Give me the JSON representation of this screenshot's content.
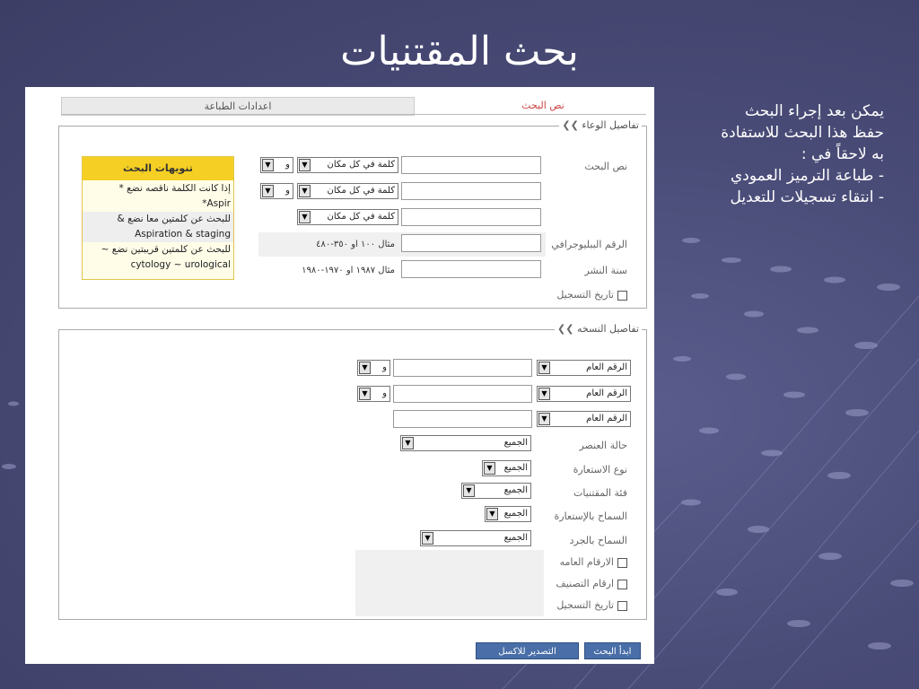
{
  "slide": {
    "title": "بحث المقتنيات",
    "notes": [
      "يمكن بعد إجراء البحث",
      "حفظ هذا البحث للاستفادة",
      "به لاحقاً في :",
      "- طباعة الترميز العمودي",
      "- انتقاء تسجيلات للتعديل"
    ]
  },
  "tabs": {
    "search_text": "نص البحث",
    "print_settings": "اعدادات الطباعة"
  },
  "container_details": {
    "legend": "تفاصيل الوعاء",
    "search_text_label": "نص البحث",
    "rows": [
      {
        "scope": "كلمة في كل مكان",
        "operator": "و"
      },
      {
        "scope": "كلمة في كل مكان",
        "operator": "و"
      },
      {
        "scope": "كلمة في كل مكان",
        "operator": ""
      }
    ],
    "biblio_label": "الرقم الببليوجرافي",
    "biblio_example": "مثال ١٠٠ او ٣٥٠-٤٨٠",
    "pub_year_label": "سنة النشر",
    "pub_year_example": "مثال ١٩٨٧ او ١٩٧٠-١٩٨٠",
    "registration_date_label": "تاريخ التسجيل"
  },
  "hints": {
    "title": "تنويهات البحث",
    "lines": [
      "إذا كانت الكلمة ناقصه نضع *",
      "Aspir*",
      "للبحث عن كلمتين معا نضع &",
      "Aspiration & staging",
      "للبحث عن كلمتين قريبتين نضع ~",
      "cytology ~ urological"
    ]
  },
  "copy_details": {
    "legend": "تفاصيل النسخه",
    "number_rows": [
      {
        "field": "الرقم العام",
        "operator": "و"
      },
      {
        "field": "الرقم العام",
        "operator": "و"
      },
      {
        "field": "الرقم العام",
        "operator": ""
      }
    ],
    "filters": [
      {
        "label": "حالة العنصر",
        "value": "الجميع"
      },
      {
        "label": "نوع الاستعارة",
        "value": "الجميع"
      },
      {
        "label": "فئة المقتنيات",
        "value": "الجميع"
      },
      {
        "label": "السماح بالإستعارة",
        "value": "الجميع"
      },
      {
        "label": "السماح بالجرد",
        "value": "الجميع"
      }
    ],
    "checkboxes": [
      "الارقام العامه",
      "ارقام التصنيف",
      "تاريخ التسجيل"
    ]
  },
  "buttons": {
    "start_search": "ابدأ البحث",
    "export_complete": "التصدير للاكسل"
  },
  "colors": {
    "background": "#4a4c78",
    "hint_header": "#f5cf24",
    "button": "#4a6fa8",
    "active_tab": "#c44"
  }
}
